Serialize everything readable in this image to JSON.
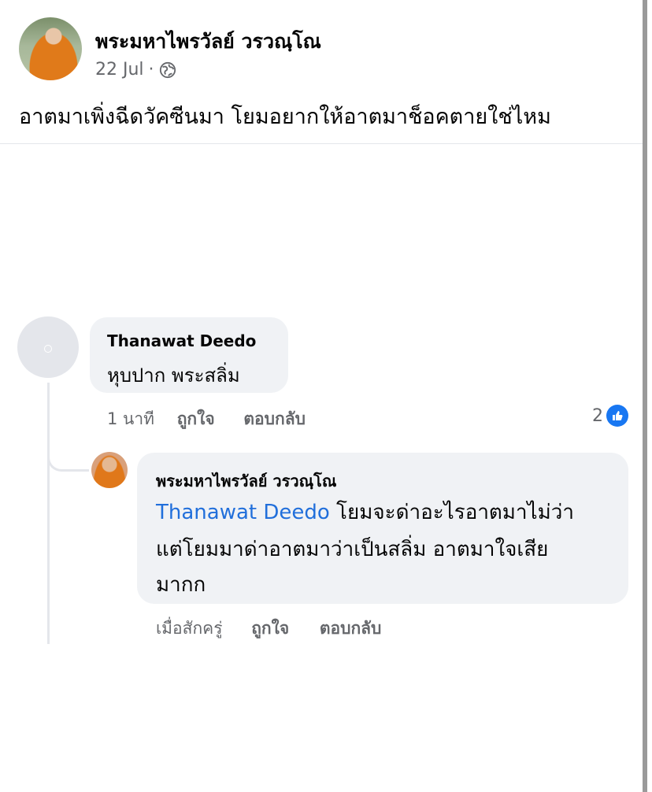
{
  "post": {
    "author": "พระมหาไพรวัลย์ วรวณฺโณ",
    "date": "22 Jul",
    "separator": "·",
    "privacy_icon": "globe-icon",
    "text": "อาตมาเพิ่งฉีดวัคซีนมา โยมอยากให้อาตมาช็อคตายใช่ไหม"
  },
  "comment": {
    "author": "Thanawat Deedo",
    "text": "หุบปาก พระสลิ่ม",
    "time": "1 นาที",
    "like_label": "ถูกใจ",
    "reply_label": "ตอบกลับ",
    "reaction_count": "2",
    "reaction_icon": "like-reaction-icon"
  },
  "reply": {
    "author": "พระมหาไพรวัลย์ วรวณฺโณ",
    "mention": "Thanawat Deedo",
    "line1_rest": " โยมจะด่าอะไรอาตมาไม่ว่า",
    "line2": "แต่โยมมาด่าอาตมาว่าเป็นสลิ่ม อาตมาใจเสีย",
    "line3": "มากก",
    "time": "เมื่อสักครู่",
    "like_label": "ถูกใจ",
    "reply_label": "ตอบกลับ"
  },
  "colors": {
    "link": "#216fdb",
    "muted": "#65676b",
    "bubble": "#f0f2f5",
    "reaction": "#1877f2"
  }
}
